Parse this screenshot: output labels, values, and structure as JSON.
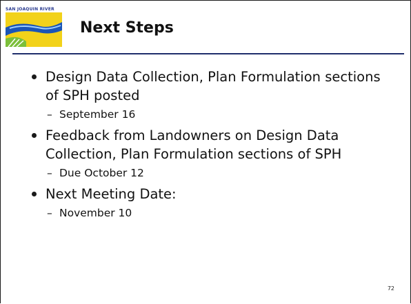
{
  "header": {
    "logo_text": "SAN JOAQUIN RIVER",
    "title": "Next Steps"
  },
  "colors": {
    "rule": "#1f2d6b",
    "logo_blue": "#1a55b8",
    "logo_yellow": "#f2d21a",
    "logo_green": "#7cbf3a"
  },
  "bullets": [
    {
      "text": "Design Data Collection, Plan Formulation sections of SPH posted",
      "sub": "September 16"
    },
    {
      "text": "Feedback from Landowners on Design Data Collection, Plan Formulation sections of SPH",
      "sub": "Due October 12"
    },
    {
      "text": "Next Meeting Date:",
      "sub": "November 10"
    }
  ],
  "sub_dash": "–",
  "footer": {
    "page_number": "72"
  }
}
